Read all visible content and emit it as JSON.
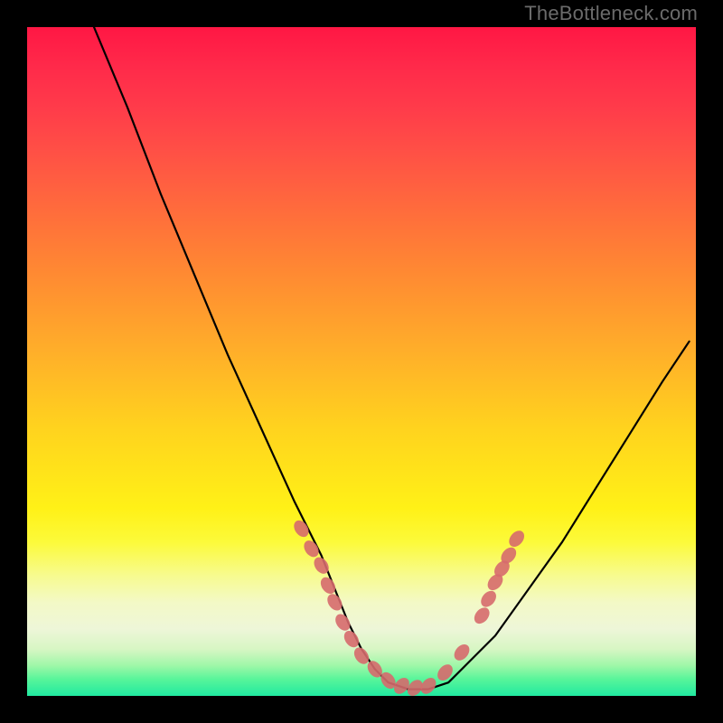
{
  "watermark": "TheBottleneck.com",
  "chart_data": {
    "type": "line",
    "title": "",
    "xlabel": "",
    "ylabel": "",
    "xlim": [
      0,
      100
    ],
    "ylim": [
      0,
      100
    ],
    "grid": false,
    "legend": false,
    "series": [
      {
        "name": "curve",
        "x": [
          10,
          15,
          20,
          25,
          30,
          35,
          40,
          42,
          44,
          46,
          48,
          50,
          52,
          54,
          57,
          60,
          63,
          66,
          70,
          75,
          80,
          85,
          90,
          95,
          99
        ],
        "y": [
          100,
          88,
          75,
          63,
          51,
          40,
          29,
          25,
          21,
          16,
          11,
          7,
          4,
          2,
          1,
          1,
          2,
          5,
          9,
          16,
          23,
          31,
          39,
          47,
          53
        ],
        "stroke": "#000000",
        "stroke_width": 2.2
      }
    ],
    "markers": [
      {
        "name": "left-cluster",
        "shape": "round",
        "color": "#d66a6d",
        "points": [
          {
            "x": 41,
            "y": 25
          },
          {
            "x": 42.5,
            "y": 22
          },
          {
            "x": 44,
            "y": 19.5
          },
          {
            "x": 45,
            "y": 16.5
          },
          {
            "x": 46,
            "y": 14
          },
          {
            "x": 47.2,
            "y": 11
          },
          {
            "x": 48.5,
            "y": 8.5
          },
          {
            "x": 50,
            "y": 6
          },
          {
            "x": 52,
            "y": 4
          },
          {
            "x": 54,
            "y": 2.3
          },
          {
            "x": 56,
            "y": 1.5
          },
          {
            "x": 58,
            "y": 1.2
          },
          {
            "x": 60,
            "y": 1.5
          }
        ]
      },
      {
        "name": "right-cluster",
        "shape": "round",
        "color": "#d66a6d",
        "points": [
          {
            "x": 62.5,
            "y": 3.5
          },
          {
            "x": 65,
            "y": 6.5
          },
          {
            "x": 68,
            "y": 12
          },
          {
            "x": 69,
            "y": 14.5
          },
          {
            "x": 70,
            "y": 17
          },
          {
            "x": 71,
            "y": 19
          },
          {
            "x": 72,
            "y": 21
          },
          {
            "x": 73.2,
            "y": 23.5
          }
        ]
      }
    ]
  }
}
